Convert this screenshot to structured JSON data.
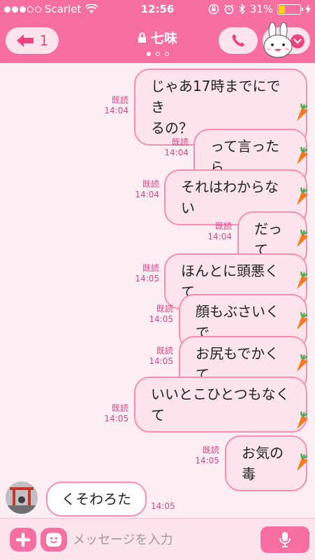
{
  "status_bar": {
    "carrier": "Scarlet",
    "time": "12:56",
    "battery": "31%",
    "battery_level": 0.31
  },
  "header": {
    "back_count": "1",
    "title": "七味",
    "page_dots": 3,
    "active_page": 0
  },
  "messages": [
    {
      "text_lines": [
        "じゃあ17時までにでき",
        "るの？"
      ],
      "read": "既読",
      "time": "14:04"
    },
    {
      "text_lines": [
        "って言ったら"
      ],
      "read": "既読",
      "time": "14:04"
    },
    {
      "text_lines": [
        "それはわからない"
      ],
      "read": "既読",
      "time": "14:04"
    },
    {
      "text_lines": [
        "だって"
      ],
      "read": "既読",
      "time": "14:04"
    },
    {
      "text_lines": [
        "ほんとに頭悪くて"
      ],
      "read": "既読",
      "time": "14:05"
    },
    {
      "text_lines": [
        "顔もぶさいくで"
      ],
      "read": "既読",
      "time": "14:05"
    },
    {
      "text_lines": [
        "お尻もでかくて"
      ],
      "read": "既読",
      "time": "14:05"
    },
    {
      "text_lines": [
        "いいとこひとつもなく",
        "て"
      ],
      "read": "既読",
      "time": "14:05"
    },
    {
      "text_lines": [
        "お気の毒"
      ],
      "read": "既読",
      "time": "14:05"
    }
  ],
  "received": {
    "text": "くそわろた",
    "time": "14:05"
  },
  "input": {
    "placeholder": "メッセージを入力"
  },
  "colors": {
    "header": "#f56fa3",
    "bubble_fill": "#fbe4ec",
    "bubble_border": "#f48fb2",
    "meta_text": "#d9468a",
    "background": "#fdeef3"
  },
  "icons": [
    "signal-dots-icon",
    "wifi-icon",
    "rotation-lock-icon",
    "alarm-icon",
    "bluetooth-icon",
    "battery-icon",
    "charging-icon",
    "back-arrow-icon",
    "lock-icon",
    "phone-icon",
    "chevron-down-icon",
    "carrot-icon",
    "plus-icon",
    "emoji-icon",
    "mic-icon"
  ]
}
